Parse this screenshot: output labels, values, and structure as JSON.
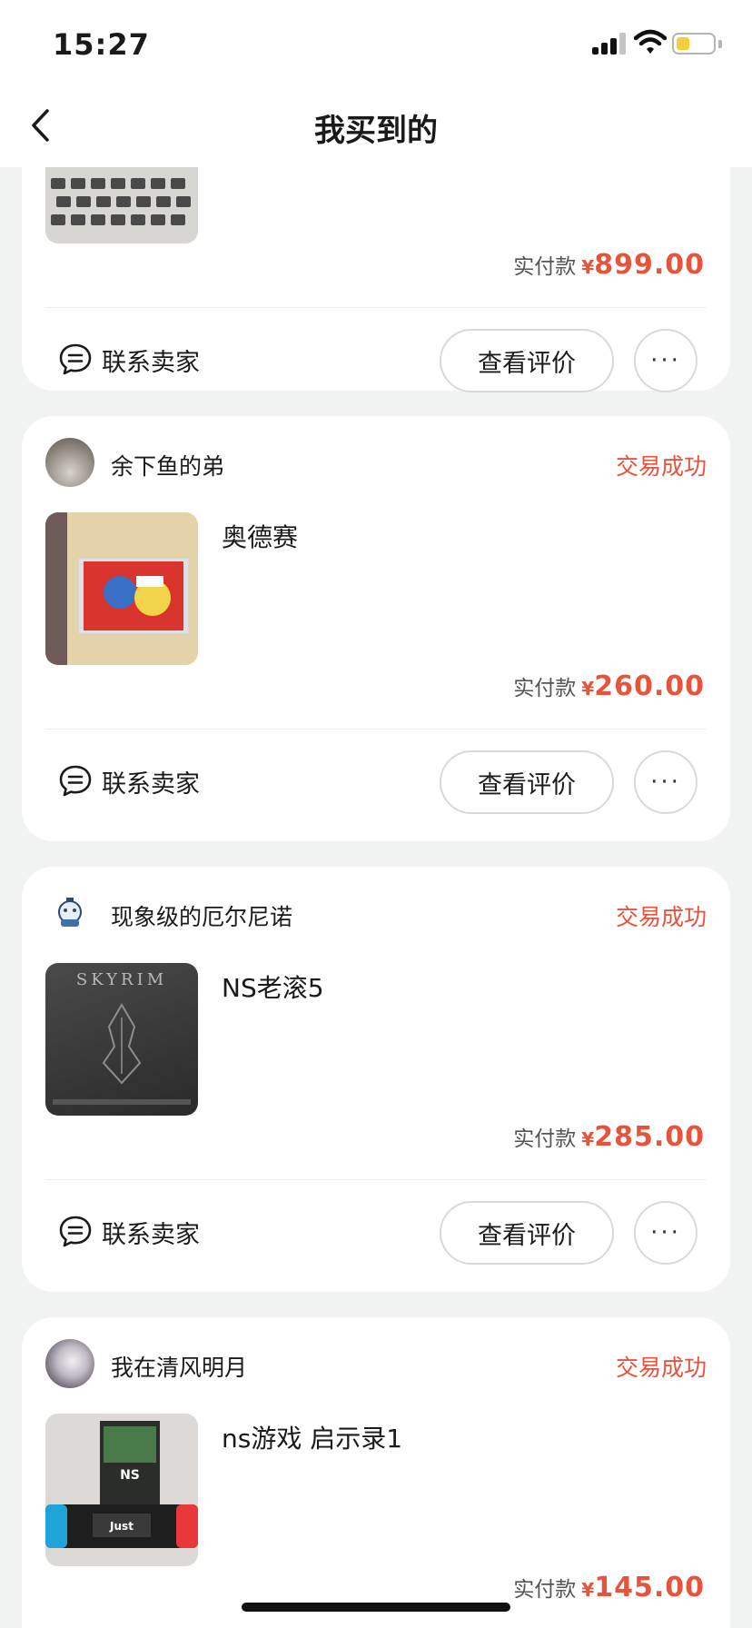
{
  "status_bar": {
    "time": "15:27"
  },
  "nav": {
    "title": "我买到的"
  },
  "labels": {
    "paid": "实付款",
    "currency": "¥",
    "contact_seller": "联系卖家",
    "view_review": "查看评价",
    "more": "···"
  },
  "orders": [
    {
      "seller": "",
      "status": "",
      "title": "",
      "price": "899.00"
    },
    {
      "seller": "余下鱼的弟",
      "status": "交易成功",
      "title": "奥德赛",
      "price": "260.00"
    },
    {
      "seller": "现象级的厄尔尼诺",
      "status": "交易成功",
      "title": "NS老滚5",
      "price": "285.00"
    },
    {
      "seller": "我在清风明月",
      "status": "交易成功",
      "title": "ns游戏 启示录1",
      "price": "145.00"
    }
  ],
  "colors": {
    "accent": "#e8533c",
    "background": "#f1f2f2",
    "card": "#ffffff"
  }
}
